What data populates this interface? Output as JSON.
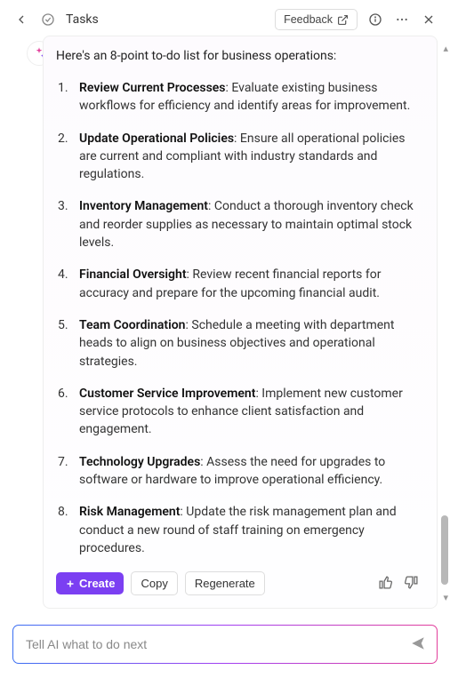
{
  "header": {
    "title": "Tasks",
    "feedback_label": "Feedback"
  },
  "intro": "Here's an 8-point to-do list for business operations:",
  "list": [
    {
      "title": "Review Current Processes",
      "desc": ": Evaluate existing business workflows for efficiency and identify areas for improvement."
    },
    {
      "title": "Update Operational Policies",
      "desc": ": Ensure all operational policies are current and compliant with industry standards and regulations."
    },
    {
      "title": "Inventory Management",
      "desc": ": Conduct a thorough inventory check and reorder supplies as necessary to maintain optimal stock levels."
    },
    {
      "title": "Financial Oversight",
      "desc": ": Review recent financial reports for accuracy and prepare for the upcoming financial audit."
    },
    {
      "title": "Team Coordination",
      "desc": ": Schedule a meeting with department heads to align on business objectives and operational strategies."
    },
    {
      "title": "Customer Service Improvement",
      "desc": ": Implement new customer service protocols to enhance client satisfaction and engagement."
    },
    {
      "title": "Technology Upgrades",
      "desc": ": Assess the need for upgrades to software or hardware to improve operational efficiency."
    },
    {
      "title": "Risk Management",
      "desc": ": Update the risk management plan and conduct a new round of staff training on emergency procedures."
    }
  ],
  "actions": {
    "create_label": "Create",
    "copy_label": "Copy",
    "regenerate_label": "Regenerate"
  },
  "input": {
    "placeholder": "Tell AI what to do next"
  }
}
